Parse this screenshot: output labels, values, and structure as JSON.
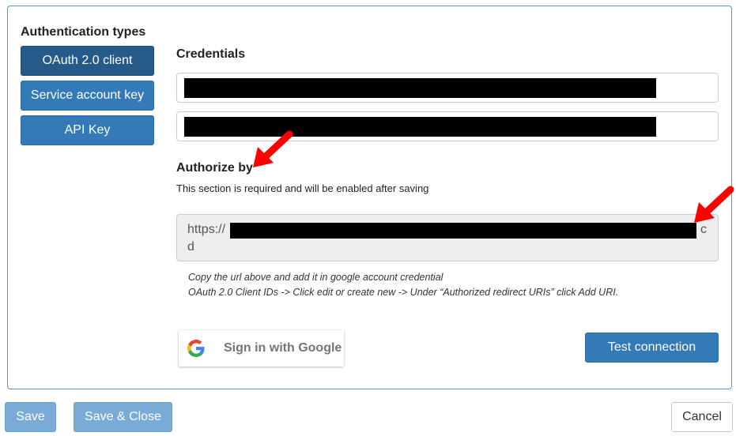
{
  "auth_types": {
    "title": "Authentication types",
    "items": [
      {
        "label": "OAuth 2.0 client",
        "active": true
      },
      {
        "label": "Service account key",
        "active": false
      },
      {
        "label": "API Key",
        "active": false
      }
    ]
  },
  "credentials": {
    "title": "Credentials"
  },
  "authorize": {
    "title": "Authorize by",
    "note": "This section is required and will be enabled after saving",
    "url_prefix": "https://",
    "url_suffix_line1": "c",
    "url_line2": "d",
    "hint_line1": "Copy the url above and add it in google account credential",
    "hint_line2": "OAuth 2.0 Client IDs -> Click edit or create new -> Under “Authorized redirect URIs” click Add URI."
  },
  "google_button": {
    "label": "Sign in with Google",
    "icon": "google-g-icon"
  },
  "test_button": {
    "label": "Test connection"
  },
  "footer": {
    "save": "Save",
    "save_close": "Save & Close",
    "cancel": "Cancel"
  },
  "colors": {
    "primary": "#337ab7",
    "primary_active": "#265a88",
    "disabled": "#7aaad6",
    "panel_border": "#4a9fd0",
    "annotation_arrow": "#ff0000"
  }
}
